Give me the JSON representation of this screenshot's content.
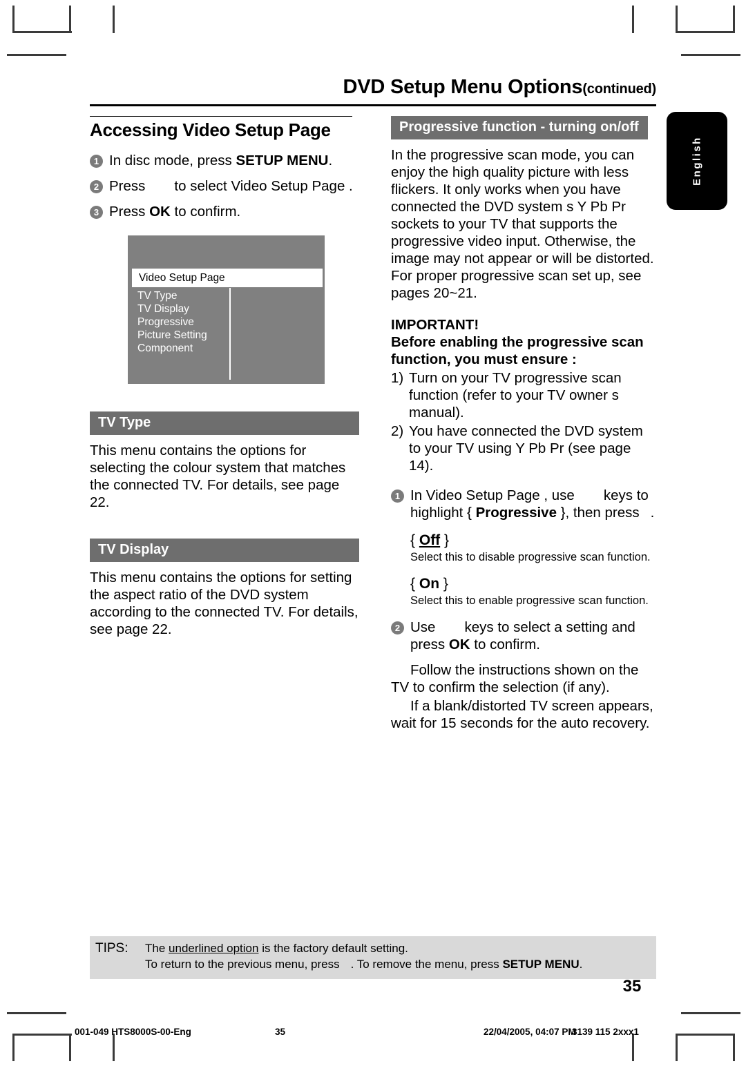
{
  "running_head": {
    "title": "DVD Setup Menu Options",
    "continued": "(continued)"
  },
  "language_tab": {
    "label": "English"
  },
  "left_column": {
    "section_title": "Accessing Video Setup Page",
    "steps": [
      {
        "num": "1",
        "pre": "In disc mode, press ",
        "bold": "SETUP MENU",
        "post": "."
      },
      {
        "num": "2",
        "pre": "Press",
        "bold": "",
        "post": "to select  Video Setup Page ."
      },
      {
        "num": "3",
        "pre": "Press ",
        "bold": "OK",
        "post": " to confirm."
      }
    ],
    "osd": {
      "title": "Video Setup Page",
      "items": [
        "TV Type",
        "TV Display",
        "Progressive",
        "Picture Setting",
        "Component"
      ]
    },
    "sections": [
      {
        "heading": "TV Type",
        "body": "This menu contains the options for selecting the colour system that matches the connected TV.  For details, see page 22."
      },
      {
        "heading": "TV Display",
        "body": "This menu contains the options for setting the aspect ratio of the DVD system according to the connected TV. For details, see page 22."
      }
    ]
  },
  "right_column": {
    "heading": "Progressive function - turning on/off",
    "intro": "In the progressive scan mode, you can enjoy the high quality picture with less flickers.  It only works when you have connected the DVD system s Y Pb Pr sockets to your TV that supports the progressive video input.  Otherwise, the image may not appear or will be distorted.  For proper progressive scan set up, see pages 20~21.",
    "important_label": "IMPORTANT!",
    "important_sub": "Before enabling the progressive scan function, you must ensure :",
    "numbered": [
      {
        "label": "1)",
        "text": "Turn on your TV progressive scan function (refer to your TV owner s manual)."
      },
      {
        "label": "2)",
        "text": "You have connected the DVD system to your TV using Y Pb Pr (see page 14)."
      }
    ],
    "step1": {
      "num": "1",
      "part_a": "In  Video Setup Page , use",
      "part_b": "keys to highlight { ",
      "bold": "Progressive",
      "part_c": " }, then press",
      "part_d": "."
    },
    "options": [
      {
        "brace_open": "{ ",
        "name": "Off",
        "brace_close": " }",
        "underlined": true,
        "desc": "Select this to disable progressive scan function."
      },
      {
        "brace_open": "{ ",
        "name": "On",
        "brace_close": " }",
        "underlined": false,
        "desc": "Select this to enable progressive scan function."
      }
    ],
    "step2": {
      "num": "2",
      "part_a": "Use",
      "part_b": "keys to select a setting and press ",
      "bold": "OK",
      "part_c": " to confirm."
    },
    "trailing_paragraphs": [
      "Follow the instructions shown on the TV to confirm the selection (if any).",
      "If a blank/distorted TV screen appears, wait for 15 seconds for the auto recovery."
    ]
  },
  "tips": {
    "label": "TIPS:",
    "line1_pre": "The ",
    "line1_underline": "underlined option",
    "line1_post": " is the factory default setting.",
    "line2_pre": "To return to the previous menu, press",
    "line2_mid": ".  To remove the menu, press ",
    "line2_bold": "SETUP MENU",
    "line2_post": "."
  },
  "folio": "35",
  "print_footer": {
    "left": "001-049 HTS8000S-00-Eng",
    "page": "35",
    "date": "22/04/2005, 04:07 PM",
    "code": "3139 115 2xxx1"
  }
}
